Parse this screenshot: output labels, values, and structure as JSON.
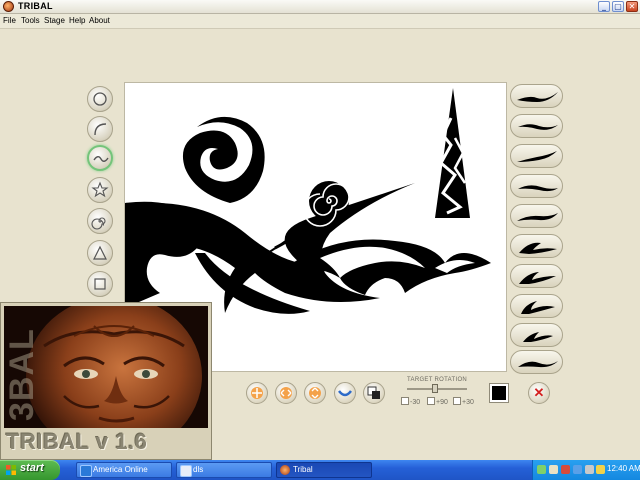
{
  "window": {
    "title": "TRIBAL"
  },
  "titlebar_buttons": {
    "minimize": "_",
    "maximize": "▢",
    "close": "✕"
  },
  "menu": [
    "File",
    "Tools",
    "Stage",
    "Help",
    "About"
  ],
  "left_tools": [
    {
      "name": "circle-tool-icon"
    },
    {
      "name": "arc-tool-icon"
    },
    {
      "name": "wave-tool-icon",
      "selected": true
    },
    {
      "name": "star-tool-icon"
    },
    {
      "name": "spiral-tool-icon"
    },
    {
      "name": "triangle-tool-icon"
    },
    {
      "name": "square-tool-icon"
    }
  ],
  "right_brushes": 10,
  "bottom_toolbar": {
    "buttons": [
      "align-center-icon",
      "align-horizontal-icon",
      "align-vertical-icon",
      "flip-icon",
      "layer-order-icon"
    ],
    "rotation_label": "TARGET ROTATION",
    "rotation_options": [
      "-30",
      "+90",
      "+30"
    ],
    "current_color": "#000000"
  },
  "splash": {
    "title": "TRIBAL v 1.6",
    "vertical_text": "3BAL"
  },
  "taskbar": {
    "start_label": "start",
    "tasks": [
      {
        "label": "America Online",
        "active": false
      },
      {
        "label": "dls",
        "active": false
      },
      {
        "label": "Tribal",
        "active": true
      }
    ],
    "clock": "12:40 AM"
  },
  "colors": {
    "accent": "#74c47a",
    "taskbar": "#2560d7",
    "start": "#3c9d33",
    "stage": "#e8e3cf"
  }
}
